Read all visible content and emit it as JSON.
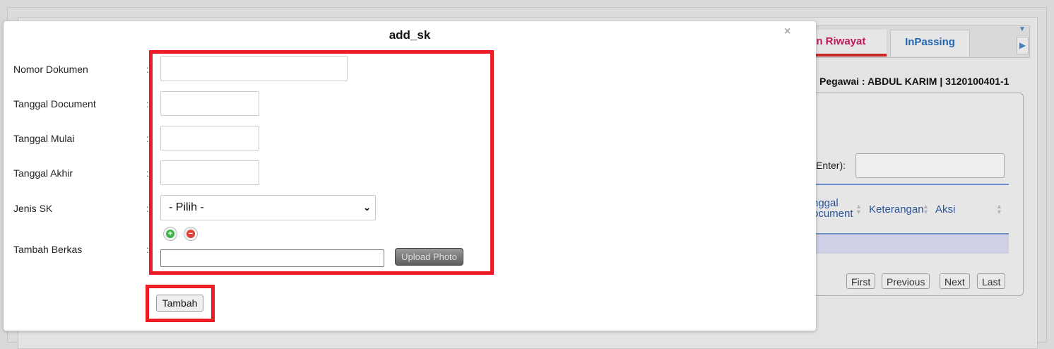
{
  "background": {
    "tabs": [
      {
        "label": "en Riwayat",
        "active": true,
        "color": "#c2185b"
      },
      {
        "label": "InPassing",
        "active": false,
        "color": "#2166b0"
      }
    ],
    "pegawai": "Pegawai : ABDUL KARIM | 3120100401-1",
    "search_label": "Enter):",
    "columns": {
      "tanggal_line1": "nggal",
      "tanggal_line2": "ocument",
      "keterangan": "Keterangan",
      "aksi": "Aksi"
    },
    "pagination": [
      "First",
      "Previous",
      "Next",
      "Last"
    ]
  },
  "modal": {
    "title": "add_sk",
    "close_icon": "×",
    "fields": {
      "nomor_dokumen": {
        "label": "Nomor Dokumen",
        "value": ""
      },
      "tanggal_document": {
        "label": "Tanggal Document",
        "value": ""
      },
      "tanggal_mulai": {
        "label": "Tanggal Mulai",
        "value": ""
      },
      "tanggal_akhir": {
        "label": "Tanggal Akhir",
        "value": ""
      },
      "jenis_sk": {
        "label": "Jenis SK",
        "selected": "- Pilih -"
      },
      "tambah_berkas": {
        "label": "Tambah Berkas",
        "upload_label": "Upload Photo"
      }
    },
    "colon": ":",
    "submit_label": "Tambah"
  },
  "colors": {
    "highlight": "#ec1c24",
    "add_icon": "#3bb54a",
    "remove_icon": "#e0413a"
  }
}
